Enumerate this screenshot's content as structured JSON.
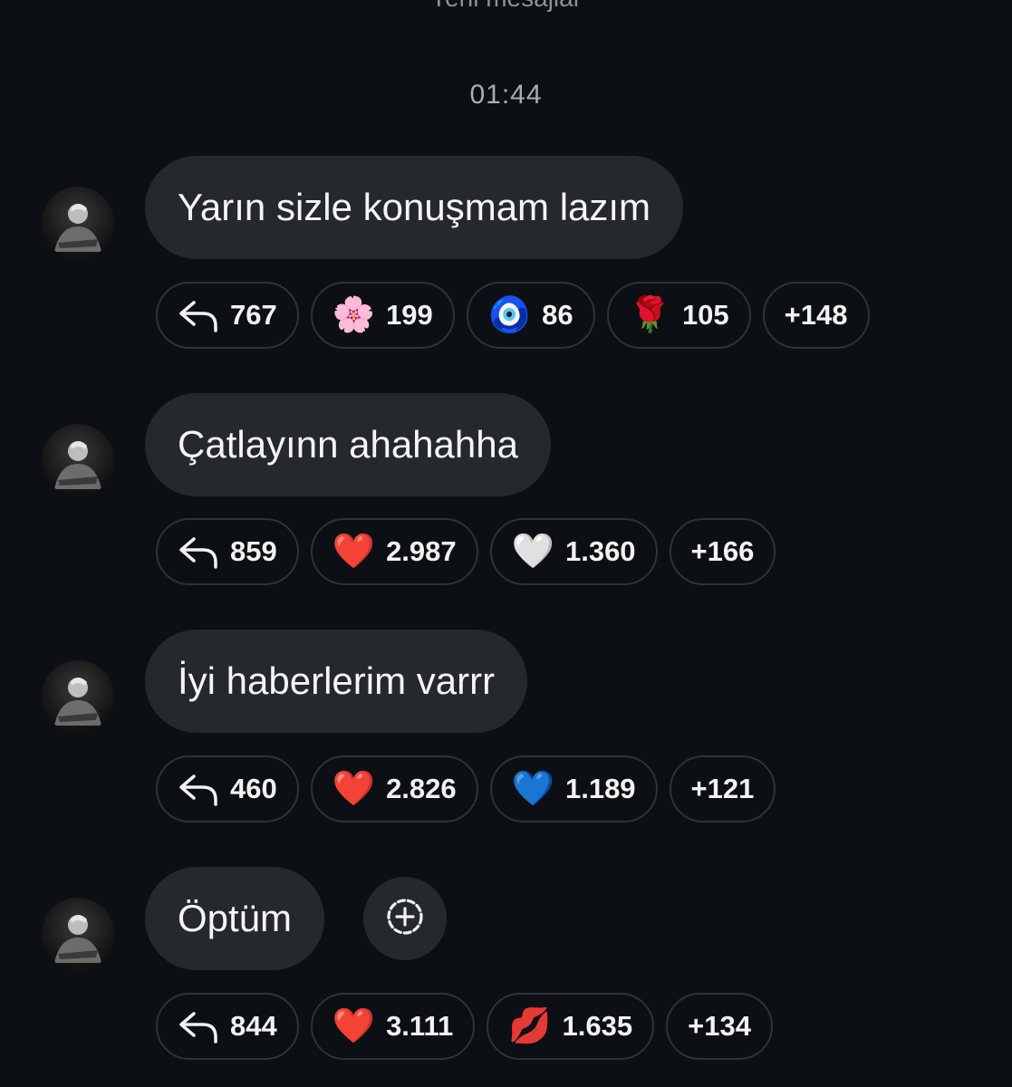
{
  "header": {
    "new_messages_label": "Yeni mesajlar",
    "timestamp": "01:44"
  },
  "messages": [
    {
      "text": "Yarın sizle konuşmam lazım",
      "reply_count": "767",
      "reactions": [
        {
          "emoji": "🌸",
          "count": "199"
        },
        {
          "emoji": "🧿",
          "count": "86"
        },
        {
          "emoji": "🌹",
          "count": "105"
        }
      ],
      "more": "+148"
    },
    {
      "text": "Çatlayınn ahahahha",
      "reply_count": "859",
      "reactions": [
        {
          "emoji": "❤️",
          "count": "2.987"
        },
        {
          "emoji": "🤍",
          "count": "1.360"
        }
      ],
      "more": "+166"
    },
    {
      "text": "İyi haberlerim varrr",
      "reply_count": "460",
      "reactions": [
        {
          "emoji": "❤️",
          "count": "2.826"
        },
        {
          "emoji": "💙",
          "count": "1.189"
        }
      ],
      "more": "+121"
    },
    {
      "text": "Öptüm",
      "reply_count": "844",
      "reactions": [
        {
          "emoji": "❤️",
          "count": "3.111"
        },
        {
          "emoji": "💋",
          "count": "1.635"
        }
      ],
      "more": "+134"
    }
  ],
  "icons": {
    "reply": "reply-arrow-icon",
    "add_reaction": "add-reaction-icon",
    "avatar": "avatar"
  },
  "colors": {
    "background": "#0c1014",
    "bubble": "#25292e",
    "chip_border": "#2f3338",
    "text": "#f5f5f5",
    "muted": "#a8adb3"
  }
}
